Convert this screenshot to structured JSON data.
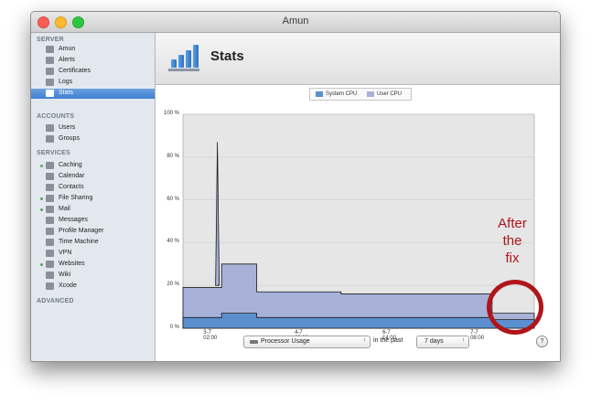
{
  "window": {
    "title": "Amun"
  },
  "sidebar": {
    "sections": {
      "server": "SERVER",
      "accounts": "ACCOUNTS",
      "services": "SERVICES",
      "advanced": "ADVANCED"
    },
    "server_items": [
      {
        "label": "Amun",
        "icon": "server-icon"
      },
      {
        "label": "Alerts",
        "icon": "alert-icon"
      },
      {
        "label": "Certificates",
        "icon": "certificate-icon"
      },
      {
        "label": "Logs",
        "icon": "logs-icon"
      },
      {
        "label": "Stats",
        "icon": "stats-icon",
        "selected": true
      }
    ],
    "account_items": [
      {
        "label": "Users",
        "icon": "user-icon"
      },
      {
        "label": "Groups",
        "icon": "groups-icon"
      }
    ],
    "service_items": [
      {
        "label": "Caching",
        "icon": "caching-icon",
        "active": true
      },
      {
        "label": "Calendar",
        "icon": "calendar-icon",
        "active": false
      },
      {
        "label": "Contacts",
        "icon": "contacts-icon",
        "active": false
      },
      {
        "label": "File Sharing",
        "icon": "file-sharing-icon",
        "active": true
      },
      {
        "label": "Mail",
        "icon": "mail-icon",
        "active": true
      },
      {
        "label": "Messages",
        "icon": "messages-icon",
        "active": false
      },
      {
        "label": "Profile Manager",
        "icon": "profile-manager-icon",
        "active": false
      },
      {
        "label": "Time Machine",
        "icon": "time-machine-icon",
        "active": false
      },
      {
        "label": "VPN",
        "icon": "vpn-icon",
        "active": false
      },
      {
        "label": "Websites",
        "icon": "websites-icon",
        "active": true
      },
      {
        "label": "Wiki",
        "icon": "wiki-icon",
        "active": false
      },
      {
        "label": "Xcode",
        "icon": "xcode-icon",
        "active": false
      }
    ]
  },
  "header": {
    "title": "Stats"
  },
  "chart_data": {
    "type": "area",
    "series": [
      {
        "name": "System CPU",
        "color": "#5b8fcf"
      },
      {
        "name": "User CPU",
        "color": "#a8b1d8"
      }
    ],
    "y_ticks": [
      "100 %",
      "80 %",
      "60 %",
      "40 %",
      "20 %",
      "0 %"
    ],
    "x_ticks": [
      "3-7 02:00",
      "4-7 20:00",
      "6-7 14:00",
      "7-7 08:00"
    ],
    "ylim": [
      0,
      100
    ],
    "segments": [
      {
        "from": 0.0,
        "to": 0.11,
        "system": 5,
        "total": 19
      },
      {
        "from": 0.11,
        "to": 0.21,
        "system": 7,
        "total": 30
      },
      {
        "from": 0.21,
        "to": 0.45,
        "system": 5,
        "total": 17
      },
      {
        "from": 0.45,
        "to": 0.71,
        "system": 5,
        "total": 16
      },
      {
        "from": 0.71,
        "to": 0.88,
        "system": 5,
        "total": 16
      },
      {
        "from": 0.88,
        "to": 1.0,
        "system": 4,
        "total": 7
      }
    ],
    "peaks": [
      {
        "at": 0.098,
        "value": 87
      }
    ]
  },
  "controls": {
    "metric": "Processor Usage",
    "in_the_past": "in the past",
    "period": "7 days",
    "help": "?"
  },
  "annotation": {
    "line1": "After",
    "line2": "the",
    "line3": "fix",
    "color": "#b0151a"
  }
}
